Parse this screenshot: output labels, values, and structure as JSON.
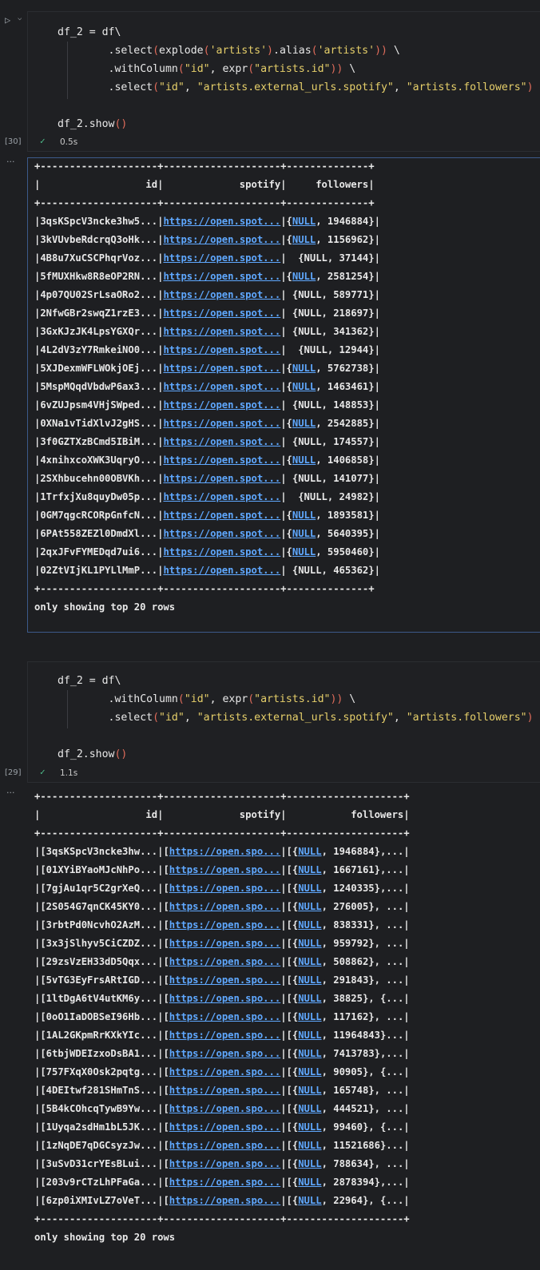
{
  "cell1": {
    "code_lines": [
      [
        {
          "t": "df_2 = df\\"
        }
      ],
      [
        {
          "t": "        .select"
        },
        {
          "t": "(",
          "c": "p"
        },
        {
          "t": "explode"
        },
        {
          "t": "(",
          "c": "p"
        },
        {
          "t": "'artists'",
          "c": "s"
        },
        {
          "t": ")",
          "c": "p"
        },
        {
          "t": ".alias"
        },
        {
          "t": "(",
          "c": "p"
        },
        {
          "t": "'artists'",
          "c": "s"
        },
        {
          "t": "))",
          "c": "p"
        },
        {
          "t": " \\"
        }
      ],
      [
        {
          "t": "        .withColumn"
        },
        {
          "t": "(",
          "c": "p"
        },
        {
          "t": "\"id\"",
          "c": "s"
        },
        {
          "t": ", expr"
        },
        {
          "t": "(",
          "c": "p"
        },
        {
          "t": "\"artists.id\"",
          "c": "s"
        },
        {
          "t": "))",
          "c": "p"
        },
        {
          "t": " \\"
        }
      ],
      [
        {
          "t": "        .select"
        },
        {
          "t": "(",
          "c": "p"
        },
        {
          "t": "\"id\"",
          "c": "s"
        },
        {
          "t": ", "
        },
        {
          "t": "\"artists.external_urls.spotify\"",
          "c": "s"
        },
        {
          "t": ", "
        },
        {
          "t": "\"artists.followers\"",
          "c": "s"
        },
        {
          "t": ")",
          "c": "p"
        }
      ],
      [
        {
          "t": ""
        }
      ],
      [
        {
          "t": "df_2.show"
        },
        {
          "t": "()",
          "c": "p"
        }
      ]
    ],
    "exec_count": "[30]",
    "exec_time": "0.5s",
    "output": {
      "border": "+--------------------+--------------------+--------------+",
      "header": "|                  id|             spotify|     followers|",
      "link_text": "https://open.spot...",
      "rows": [
        {
          "id": "|3qsKSpcV3ncke3hw5...|",
          "f": "|{NULL, 1946884}|"
        },
        {
          "id": "|3kVUvbeRdcrqQ3oHk...|",
          "f": "|{NULL, 1156962}|"
        },
        {
          "id": "|4B8u7XuCSCPhqrVoz...|",
          "f": "|  {NULL, 37144}|"
        },
        {
          "id": "|5fMUXHkw8R8eOP2RN...|",
          "f": "|{NULL, 2581254}|"
        },
        {
          "id": "|4p07QU02SrLsaORo2...|",
          "f": "| {NULL, 589771}|"
        },
        {
          "id": "|2NfwGBr2swqZ1rzE3...|",
          "f": "| {NULL, 218697}|"
        },
        {
          "id": "|3GxKJzJK4LpsYGXQr...|",
          "f": "| {NULL, 341362}|"
        },
        {
          "id": "|4L2dV3zY7RmkeiNO0...|",
          "f": "|  {NULL, 12944}|"
        },
        {
          "id": "|5XJDexmWFLWOkjOEj...|",
          "f": "|{NULL, 5762738}|"
        },
        {
          "id": "|5MspMQqdVbdwP6ax3...|",
          "f": "|{NULL, 1463461}|"
        },
        {
          "id": "|6vZUJpsm4VHjSWped...|",
          "f": "| {NULL, 148853}|"
        },
        {
          "id": "|0XNa1vTidXlvJ2gHS...|",
          "f": "|{NULL, 2542885}|"
        },
        {
          "id": "|3f0GZTXzBCmd5IBiM...|",
          "f": "| {NULL, 174557}|"
        },
        {
          "id": "|4xnihxcoXWK3UqryO...|",
          "f": "|{NULL, 1406858}|"
        },
        {
          "id": "|2SXhbucehn00OBVKh...|",
          "f": "| {NULL, 141077}|"
        },
        {
          "id": "|1TrfxjXu8quyDw05p...|",
          "f": "|  {NULL, 24982}|"
        },
        {
          "id": "|0GM7qgcRCORpGnfcN...|",
          "f": "|{NULL, 1893581}|"
        },
        {
          "id": "|6PAt558ZEZl0DmdXl...|",
          "f": "|{NULL, 5640395}|"
        },
        {
          "id": "|2qxJFvFYMEDqd7ui6...|",
          "f": "|{NULL, 5950460}|"
        },
        {
          "id": "|02ZtVIjKL1PYLlMmP...|",
          "f": "| {NULL, 465362}|"
        }
      ],
      "footer": "only showing top 20 rows"
    }
  },
  "cell2": {
    "code_lines": [
      [
        {
          "t": "df_2 = df\\"
        }
      ],
      [
        {
          "t": "        .withColumn"
        },
        {
          "t": "(",
          "c": "p"
        },
        {
          "t": "\"id\"",
          "c": "s"
        },
        {
          "t": ", expr"
        },
        {
          "t": "(",
          "c": "p"
        },
        {
          "t": "\"artists.id\"",
          "c": "s"
        },
        {
          "t": "))",
          "c": "p"
        },
        {
          "t": " \\"
        }
      ],
      [
        {
          "t": "        .select"
        },
        {
          "t": "(",
          "c": "p"
        },
        {
          "t": "\"id\"",
          "c": "s"
        },
        {
          "t": ", "
        },
        {
          "t": "\"artists.external_urls.spotify\"",
          "c": "s"
        },
        {
          "t": ", "
        },
        {
          "t": "\"artists.followers\"",
          "c": "s"
        },
        {
          "t": ")",
          "c": "p"
        }
      ],
      [
        {
          "t": ""
        }
      ],
      [
        {
          "t": "df_2.show"
        },
        {
          "t": "()",
          "c": "p"
        }
      ]
    ],
    "exec_count": "[29]",
    "exec_time": "1.1s",
    "output": {
      "border": "+--------------------+--------------------+--------------------+",
      "header": "|                  id|             spotify|           followers|",
      "link_text": "https://open.spo...",
      "rows": [
        {
          "id": "|[3qsKSpcV3ncke3hw...|",
          "n": ", 1946884},...|"
        },
        {
          "id": "|[01XYiBYaoMJcNhPo...|",
          "n": ", 1667161},...|"
        },
        {
          "id": "|[7gjAu1qr5C2grXeQ...|",
          "n": ", 1240335},...|"
        },
        {
          "id": "|[2S054G7qnCK45KY0...|",
          "n": ", 276005}, ...|"
        },
        {
          "id": "|[3rbtPd0NcvhO2AzM...|",
          "n": ", 838331}, ...|"
        },
        {
          "id": "|[3x3jSlhyv5CiCZDZ...|",
          "n": ", 959792}, ...|"
        },
        {
          "id": "|[29zsVzEH33dD5Qqx...|",
          "n": ", 508862}, ...|"
        },
        {
          "id": "|[5vTG3EyFrsARtIGD...|",
          "n": ", 291843}, ...|"
        },
        {
          "id": "|[1ltDgA6tV4utKM6y...|",
          "n": ", 38825}, {...|"
        },
        {
          "id": "|[0oO1IaDOBSeI96Hb...|",
          "n": ", 117162}, ...|"
        },
        {
          "id": "|[1AL2GKpmRrKXkYIc...|",
          "n": ", 11964843}...|"
        },
        {
          "id": "|[6tbjWDEIzxoDsBA1...|",
          "n": ", 7413783},...|"
        },
        {
          "id": "|[757FXqX0Osk2pqtg...|",
          "n": ", 90905}, {...|"
        },
        {
          "id": "|[4DEItwf281SHmTnS...|",
          "n": ", 165748}, ...|"
        },
        {
          "id": "|[5B4kCOhcqTywB9Yw...|",
          "n": ", 444521}, ...|"
        },
        {
          "id": "|[1Uyqa2sdHm1bL5JK...|",
          "n": ", 99460}, {...|"
        },
        {
          "id": "|[1zNqDE7qDGCsyzJw...|",
          "n": ", 11521686}...|"
        },
        {
          "id": "|[3uSvD31crYEsBLui...|",
          "n": ", 788634}, ...|"
        },
        {
          "id": "|[203v9rCTzLhPFaGa...|",
          "n": ", 2878394},...|"
        },
        {
          "id": "|[6zp0iXMIvLZ7oVeT...|",
          "n": ", 22964}, {...|"
        }
      ],
      "footer": "only showing top 20 rows"
    }
  }
}
